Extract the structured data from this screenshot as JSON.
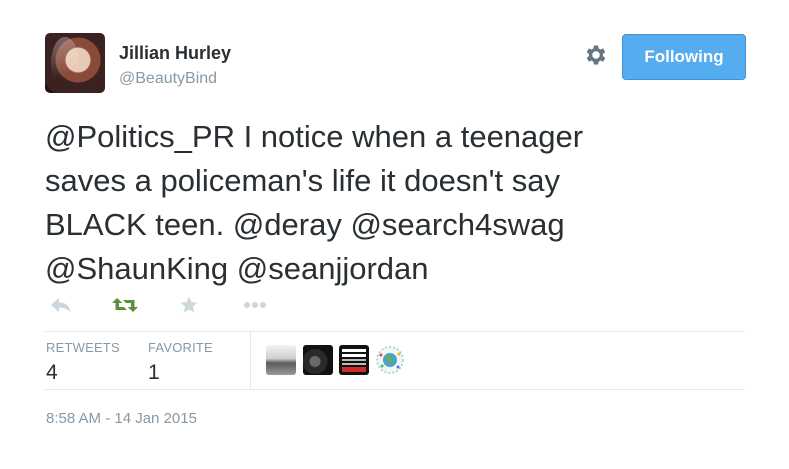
{
  "author": {
    "name": "Jillian Hurley",
    "handle": "@BeautyBind"
  },
  "header": {
    "follow_button_label": "Following"
  },
  "tweet": {
    "line1": "@Politics_PR I notice when a teenager",
    "line2": "saves a policeman's life it doesn't say",
    "line3": "BLACK teen. @deray @search4swag",
    "line4": "@ShaunKing @seanjjordan"
  },
  "actions": [
    "reply-icon",
    "retweet-icon",
    "favorite-icon",
    "more-icon"
  ],
  "stats": {
    "retweets_label": "RETWEETS",
    "retweets_value": "4",
    "favorites_label": "FAVORITE",
    "favorites_value": "1"
  },
  "colors": {
    "accent": "#55acee",
    "retweet_green": "#5c913b",
    "muted": "#8899a6",
    "text": "#292f33"
  },
  "timestamp": "8:58 AM - 14 Jan 2015"
}
